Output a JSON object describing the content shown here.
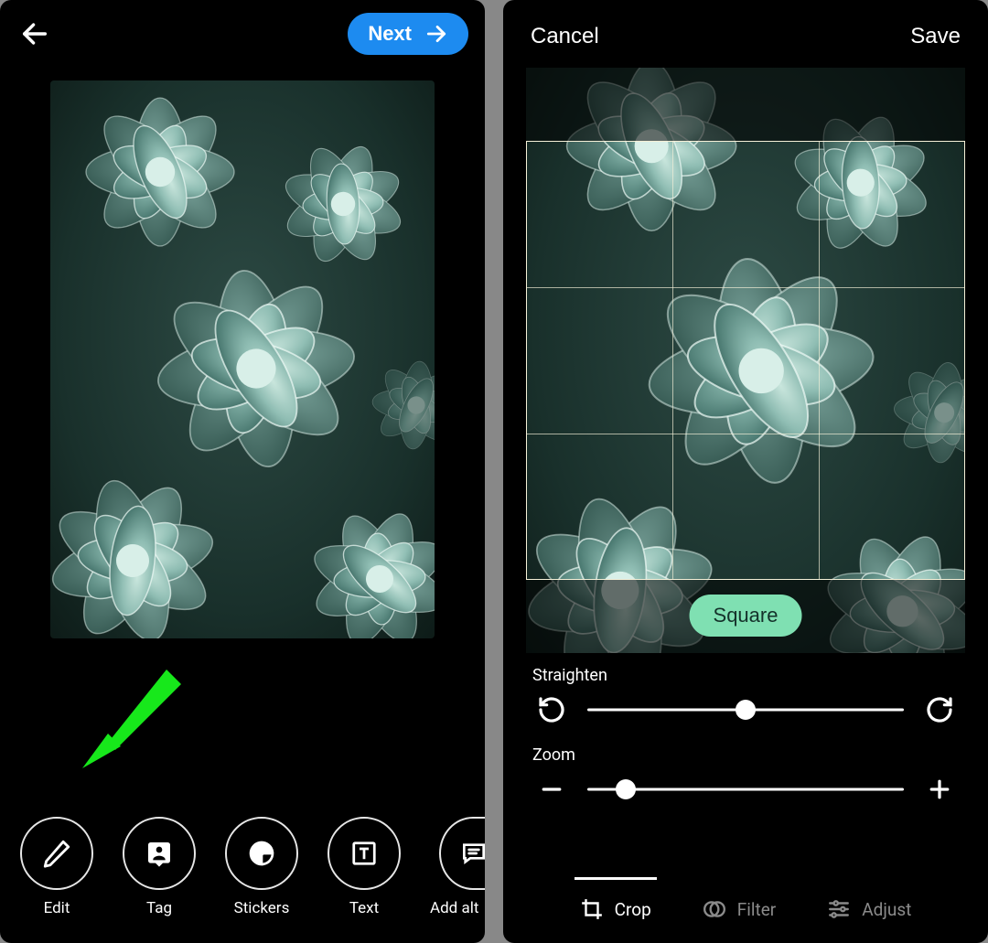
{
  "left": {
    "header": {
      "next_label": "Next"
    },
    "tools": [
      {
        "key": "edit",
        "label": "Edit"
      },
      {
        "key": "tag",
        "label": "Tag"
      },
      {
        "key": "stickers",
        "label": "Stickers"
      },
      {
        "key": "text",
        "label": "Text"
      },
      {
        "key": "addalt",
        "label": "Add alt"
      }
    ],
    "annotation": {
      "arrow_target": "edit"
    }
  },
  "right": {
    "header": {
      "cancel_label": "Cancel",
      "save_label": "Save"
    },
    "crop": {
      "aspect_label": "Square"
    },
    "straighten": {
      "label": "Straighten",
      "value_pct": 50
    },
    "zoom": {
      "label": "Zoom",
      "value_pct": 12
    },
    "tabs": [
      {
        "key": "crop",
        "label": "Crop",
        "active": true
      },
      {
        "key": "filter",
        "label": "Filter",
        "active": false
      },
      {
        "key": "adjust",
        "label": "Adjust",
        "active": false
      }
    ]
  },
  "colors": {
    "accent_blue": "#1d8bf0",
    "accent_green": "#7fe0b2",
    "annot_green": "#17e81b"
  }
}
